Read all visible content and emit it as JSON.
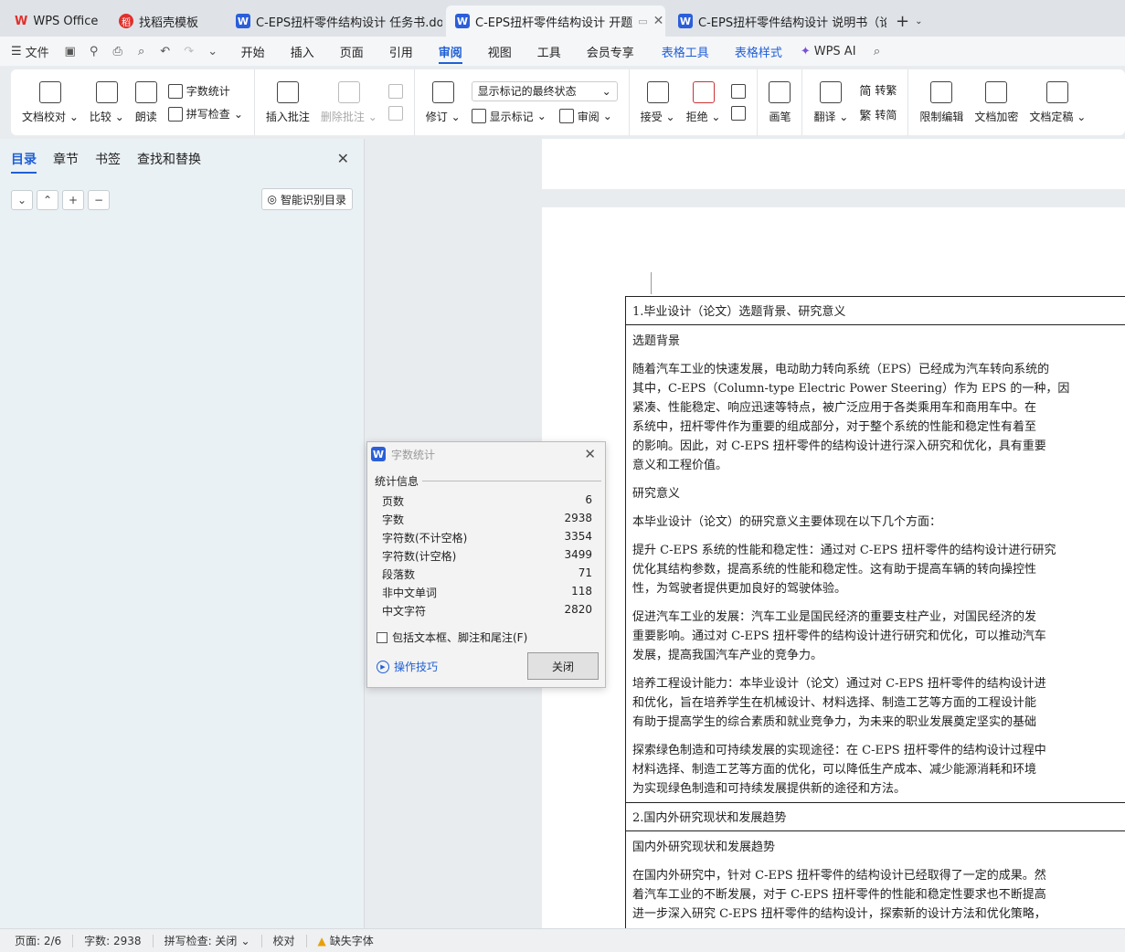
{
  "tabs": [
    {
      "label": "WPS Office",
      "icon": "wps-logo-icon"
    },
    {
      "label": "找稻壳模板",
      "icon": "daoke-icon"
    },
    {
      "label": "C-EPS扭杆零件结构设计 任务书.doc",
      "icon": "word-doc-icon"
    },
    {
      "label": "C-EPS扭杆零件结构设计 开题",
      "icon": "word-doc-icon",
      "active": true
    },
    {
      "label": "C-EPS扭杆零件结构设计 说明书（论文",
      "icon": "word-doc-icon"
    }
  ],
  "menu": {
    "file": "文件",
    "tabs": [
      "开始",
      "插入",
      "页面",
      "引用",
      "审阅",
      "视图",
      "工具",
      "会员专享"
    ],
    "active_tab": "审阅",
    "context_tabs": [
      "表格工具",
      "表格样式"
    ],
    "ai": "WPS AI"
  },
  "ribbon": {
    "proofread": "文档校对",
    "compare": "比较",
    "read_aloud": "朗读",
    "word_count": "字数统计",
    "spell_check": "拼写检查",
    "insert_comment": "插入批注",
    "delete_comment": "删除批注",
    "track_changes": "修订",
    "markup_state": "显示标记的最终状态",
    "show_markup": "显示标记",
    "review": "审阅",
    "accept": "接受",
    "reject": "拒绝",
    "ink": "画笔",
    "translate": "翻译",
    "to_traditional": "转繁",
    "to_simplified": "转简",
    "restrict_edit": "限制编辑",
    "encrypt": "文档加密",
    "finalize": "文档定稿"
  },
  "nav": {
    "tabs": [
      "目录",
      "章节",
      "书签",
      "查找和替换"
    ],
    "smart_toc": "智能识别目录"
  },
  "document": {
    "section1_title": "1.毕业设计（论文）选题背景、研究意义",
    "sub1": "选题背景",
    "p1": [
      "随着汽车工业的快速发展，电动助力转向系统（EPS）已经成为汽车转向系统的",
      "其中，C-EPS（Column-type Electric Power Steering）作为 EPS 的一种，因",
      "紧凑、性能稳定、响应迅速等特点，被广泛应用于各类乘用车和商用车中。在",
      "系统中，扭杆零件作为重要的组成部分，对于整个系统的性能和稳定性有着至",
      "的影响。因此，对 C-EPS 扭杆零件的结构设计进行深入研究和优化，具有重要",
      "意义和工程价值。"
    ],
    "sub2": "研究意义",
    "p2": [
      "本毕业设计（论文）的研究意义主要体现在以下几个方面："
    ],
    "p3": [
      "提升 C-EPS 系统的性能和稳定性：通过对 C-EPS 扭杆零件的结构设计进行研究",
      "优化其结构参数，提高系统的性能和稳定性。这有助于提高车辆的转向操控性",
      "性，为驾驶者提供更加良好的驾驶体验。"
    ],
    "p4": [
      "促进汽车工业的发展：汽车工业是国民经济的重要支柱产业，对国民经济的发",
      "重要影响。通过对 C-EPS 扭杆零件的结构设计进行研究和优化，可以推动汽车",
      "发展，提高我国汽车产业的竞争力。"
    ],
    "p5": [
      "培养工程设计能力：本毕业设计（论文）通过对 C-EPS 扭杆零件的结构设计进",
      "和优化，旨在培养学生在机械设计、材料选择、制造工艺等方面的工程设计能",
      "有助于提高学生的综合素质和就业竞争力，为未来的职业发展奠定坚实的基础"
    ],
    "p6": [
      "探索绿色制造和可持续发展的实现途径：在 C-EPS 扭杆零件的结构设计过程中",
      "材料选择、制造工艺等方面的优化，可以降低生产成本、减少能源消耗和环境",
      "为实现绿色制造和可持续发展提供新的途径和方法。"
    ],
    "section2_title": "2.国内外研究现状和发展趋势",
    "sub3": "国内外研究现状和发展趋势",
    "p7": [
      "在国内外研究中，针对 C-EPS 扭杆零件的结构设计已经取得了一定的成果。然",
      "着汽车工业的不断发展，对于 C-EPS 扭杆零件的性能和稳定性要求也不断提高",
      "进一步深入研究 C-EPS 扭杆零件的结构设计，探索新的设计方法和优化策略，"
    ]
  },
  "dialog": {
    "title": "字数统计",
    "section": "统计信息",
    "stats": [
      {
        "label": "页数",
        "value": "6"
      },
      {
        "label": "字数",
        "value": "2938"
      },
      {
        "label": "字符数(不计空格)",
        "value": "3354"
      },
      {
        "label": "字符数(计空格)",
        "value": "3499"
      },
      {
        "label": "段落数",
        "value": "71"
      },
      {
        "label": "非中文单词",
        "value": "118"
      },
      {
        "label": "中文字符",
        "value": "2820"
      }
    ],
    "checkbox": "包括文本框、脚注和尾注(F)",
    "tips": "操作技巧",
    "close": "关闭"
  },
  "status": {
    "page": "页面: 2/6",
    "words": "字数: 2938",
    "spell": "拼写检查: 关闭",
    "proof": "校对",
    "missing_font": "缺失字体"
  }
}
